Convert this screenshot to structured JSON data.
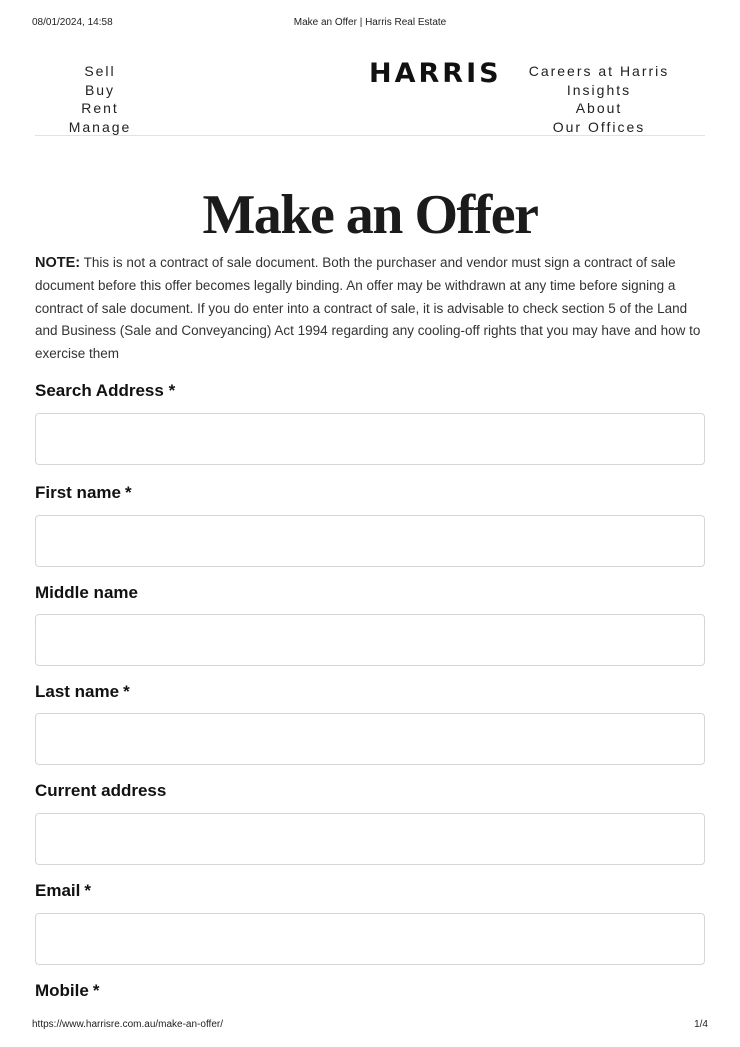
{
  "print_header": {
    "datetime": "08/01/2024, 14:58",
    "page_title": "Make an Offer | Harris Real Estate"
  },
  "nav": {
    "left": [
      "Sell",
      "Buy",
      "Rent",
      "Manage"
    ],
    "logo": "HARRIS",
    "right": [
      "Careers at Harris",
      "Insights",
      "About",
      "Our Offices"
    ]
  },
  "main": {
    "title": "Make an Offer",
    "note_label": "NOTE:",
    "note_text": " This is not a contract of sale document. Both the purchaser and vendor must sign a contract of sale document before this offer becomes legally binding. An offer may be withdrawn at any time before signing a contract of sale document. If you do enter into a contract of sale, it is advisable to check section 5 of the Land and Business (Sale and Conveyancing) Act 1994 regarding any cooling-off rights that you may have and how to exercise them"
  },
  "form": {
    "search_address": {
      "label": "Search Address",
      "required": "*",
      "value": ""
    },
    "first_name": {
      "label": "First name",
      "required": "*",
      "value": ""
    },
    "middle_name": {
      "label": "Middle name",
      "value": ""
    },
    "last_name": {
      "label": "Last name",
      "required": "*",
      "value": ""
    },
    "current_address": {
      "label": "Current address",
      "value": ""
    },
    "email": {
      "label": "Email",
      "required": "*",
      "value": ""
    },
    "mobile": {
      "label": "Mobile",
      "required": "*"
    }
  },
  "print_footer": {
    "url": "https://www.harrisre.com.au/make-an-offer/",
    "page": "1/4"
  }
}
